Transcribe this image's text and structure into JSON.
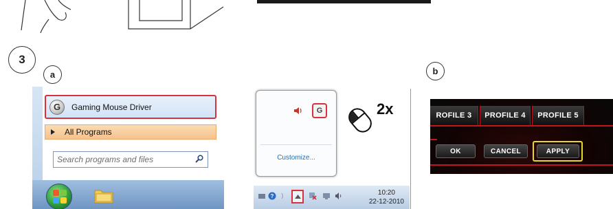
{
  "steps": {
    "main": "3",
    "sub_a": "a",
    "sub_b": "b"
  },
  "start_menu": {
    "program_label": "Gaming Mouse Driver",
    "program_icon_letter": "G",
    "all_programs_label": "All Programs",
    "search_placeholder": "Search programs and files"
  },
  "tray_popup": {
    "customize_label": "Customize...",
    "app_icon_letter": "G",
    "double_click_label": "2x"
  },
  "taskbar": {
    "time": "10:20",
    "date": "22-12-2010"
  },
  "profile_panel": {
    "tabs": [
      "ROFILE 3",
      "PROFILE 4",
      "PROFILE 5"
    ],
    "buttons": {
      "ok": "OK",
      "cancel": "CANCEL",
      "apply": "APPLY"
    }
  },
  "colors": {
    "highlight_red": "#d9303a",
    "highlight_yellow": "#e6d92a",
    "link_blue": "#1f6fb6"
  }
}
